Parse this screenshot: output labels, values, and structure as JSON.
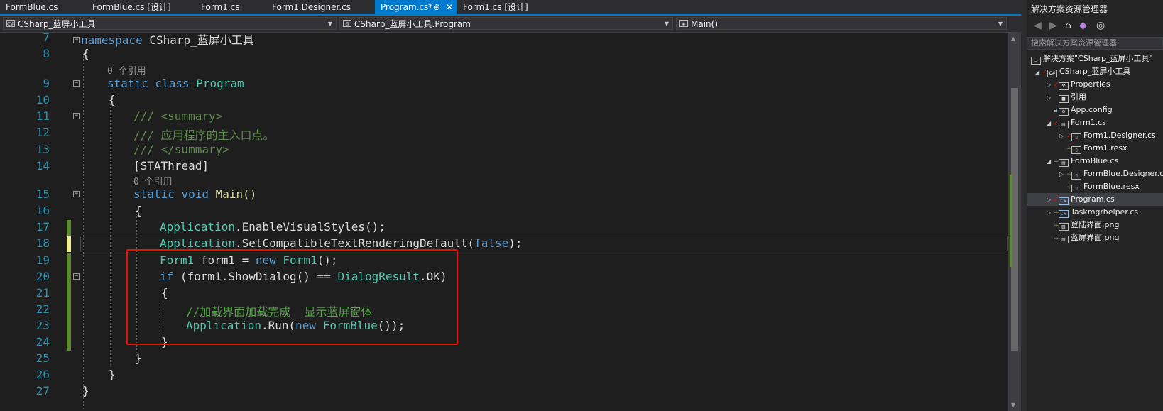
{
  "tabs": [
    {
      "label": "FormBlue.cs",
      "active": false
    },
    {
      "label": "FormBlue.cs [设计]",
      "active": false
    },
    {
      "label": "Form1.cs",
      "active": false
    },
    {
      "label": "Form1.Designer.cs",
      "active": false
    },
    {
      "label": "Program.cs*",
      "active": true
    },
    {
      "label": "Form1.cs [设计]",
      "active": false
    }
  ],
  "tab_icons": {
    "pin": "⊕",
    "close": "✕",
    "overflow": "▾"
  },
  "navbar": {
    "project": "CSharp_蓝屏小工具",
    "class": "CSharp_蓝屏小工具.Program",
    "member": "Main()"
  },
  "code": {
    "lines": [
      {
        "num": "7"
      },
      {
        "num": "8"
      },
      {
        "num": "9"
      },
      {
        "num": "10"
      },
      {
        "num": "11"
      },
      {
        "num": "12"
      },
      {
        "num": "13"
      },
      {
        "num": "14"
      },
      {
        "num": "15"
      },
      {
        "num": "16"
      },
      {
        "num": "17"
      },
      {
        "num": "18"
      },
      {
        "num": "19"
      },
      {
        "num": "20"
      },
      {
        "num": "21"
      },
      {
        "num": "22"
      },
      {
        "num": "23"
      },
      {
        "num": "24"
      },
      {
        "num": "25"
      },
      {
        "num": "26"
      },
      {
        "num": "27"
      }
    ],
    "t": {
      "namespace_kw": "namespace",
      "namespace_name": " CSharp_蓝屏小工具",
      "brace_open": "{",
      "brace_close": "}",
      "ref0": "0 个引用",
      "static": "static",
      "class_kw": " class ",
      "program": "Program",
      "doc1": "/// <summary>",
      "doc2": "/// 应用程序的主入口点。",
      "doc3": "/// </summary>",
      "attr": "[STAThread]",
      "ref1": "0 个引用",
      "void_kw": " void ",
      "main": "Main()",
      "app": "Application",
      "enable": ".EnableVisualStyles();",
      "setcomp": ".SetCompatibleTextRenderingDefault(",
      "false_kw": "false",
      "close_paren": ");",
      "form1_type": "Form1",
      "form1_decl": " form1 = ",
      "new_kw": "new",
      "form1_ctor": " Form1",
      "ctor_end": "();",
      "if_kw": "if",
      "if_cond": " (form1.ShowDialog() == ",
      "dialogresult": "DialogResult",
      "ok": ".OK)",
      "comment": "//加载界面加载完成  显示蓝屏窗体",
      "run": ".Run(",
      "formblue": "FormBlue",
      "run_end": "());"
    }
  },
  "solution": {
    "title": "解决方案资源管理器",
    "search_placeholder": "搜索解决方案资源管理器",
    "nodes": [
      {
        "label": "解决方案\"CSharp_蓝屏小工具\""
      },
      {
        "label": "CSharp_蓝屏小工具"
      },
      {
        "label": "Properties"
      },
      {
        "label": "引用"
      },
      {
        "label": "App.config"
      },
      {
        "label": "Form1.cs"
      },
      {
        "label": "Form1.Designer.cs"
      },
      {
        "label": "Form1.resx"
      },
      {
        "label": "FormBlue.cs"
      },
      {
        "label": "FormBlue.Designer.cs"
      },
      {
        "label": "FormBlue.resx"
      },
      {
        "label": "Program.cs"
      },
      {
        "label": "Taskmgrhelper.cs"
      },
      {
        "label": "登陆界面.png"
      },
      {
        "label": "蓝屏界面.png"
      }
    ]
  },
  "colors": {
    "accent": "#007acc",
    "highlight_box": "#e51400",
    "keyword": "#569cd6",
    "type": "#4ec9b0",
    "comment": "#57a64a"
  }
}
